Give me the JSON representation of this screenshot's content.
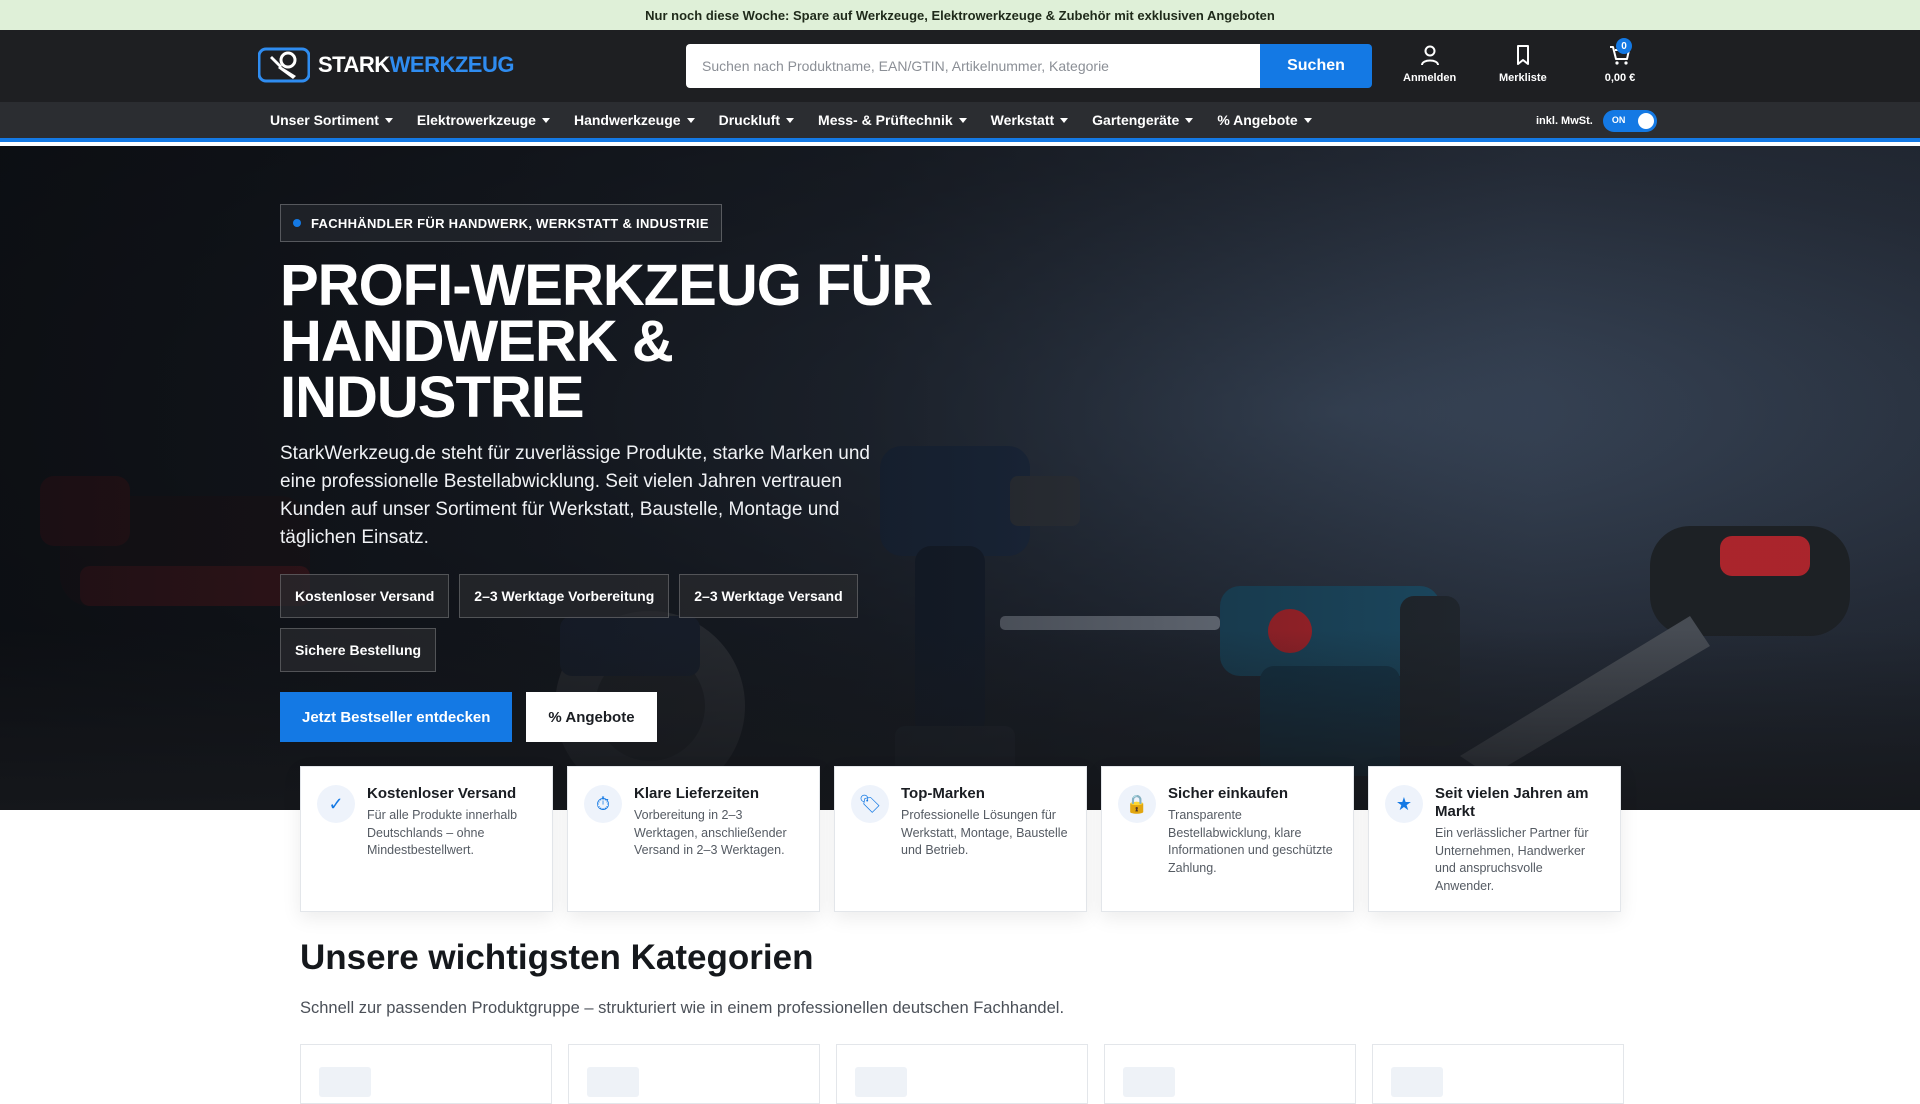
{
  "promo": {
    "text": "Nur noch diese Woche: Spare auf Werkzeuge, Elektrowerkzeuge & Zubehör mit exklusiven Angeboten"
  },
  "header": {
    "logo_part1": "STARK",
    "logo_part2": "WERKZEUG",
    "search_placeholder": "Suchen nach Produktname, EAN/GTIN, Artikelnummer, Kategorie",
    "search_button": "Suchen",
    "login_label": "Anmelden",
    "wishlist_label": "Merkliste",
    "cart_count": "0",
    "cart_total": "0,00 €"
  },
  "nav": {
    "items": [
      {
        "label": "Unser Sortiment"
      },
      {
        "label": "Elektrowerkzeuge"
      },
      {
        "label": "Handwerkzeuge"
      },
      {
        "label": "Druckluft"
      },
      {
        "label": "Mess- & Prüftechnik"
      },
      {
        "label": "Werkstatt"
      },
      {
        "label": "Gartengeräte"
      },
      {
        "label": "% Angebote"
      }
    ],
    "vat_label": "inkl. MwSt.",
    "vat_toggle": "ON"
  },
  "hero": {
    "eyebrow": "FACHHÄNDLER FÜR HANDWERK, WERKSTATT & INDUSTRIE",
    "title": "PROFI-WERKZEUG FÜR HANDWERK & INDUSTRIE",
    "text": "StarkWerkzeug.de steht für zuverlässige Produkte, starke Marken und eine professionelle Bestellabwicklung. Seit vielen Jahren vertrauen Kunden auf unser Sortiment für Werkstatt, Baustelle, Montage und täglichen Einsatz.",
    "chips": [
      {
        "label": "Kostenloser Versand"
      },
      {
        "label": "2–3 Werktage Vorbereitung"
      },
      {
        "label": "2–3 Werktage Versand"
      },
      {
        "label": "Sichere Bestellung"
      }
    ],
    "cta_primary": "Jetzt Bestseller entdecken",
    "cta_secondary": "% Angebote"
  },
  "features": [
    {
      "icon": "✓",
      "title": "Kostenloser Versand",
      "desc": "Für alle Produkte innerhalb Deutschlands – ohne Mindestbestellwert."
    },
    {
      "icon": "⏱",
      "title": "Klare Lieferzeiten",
      "desc": "Vorbereitung in 2–3 Werktagen, anschließender Versand in 2–3 Werktagen."
    },
    {
      "icon": "🏷",
      "title": "Top-Marken",
      "desc": "Professionelle Lösungen für Werkstatt, Montage, Baustelle und Betrieb."
    },
    {
      "icon": "🔒",
      "title": "Sicher einkaufen",
      "desc": "Transparente Bestellabwicklung, klare Informationen und geschützte Zahlung."
    },
    {
      "icon": "★",
      "title": "Seit vielen Jahren am Markt",
      "desc": "Ein verlässlicher Partner für Unternehmen, Handwerker und anspruchsvolle Anwender."
    }
  ],
  "categories": {
    "title": "Unsere wichtigsten Kategorien",
    "subtitle": "Schnell zur passenden Produktgruppe – strukturiert wie in einem professionellen deutschen Fachhandel."
  },
  "colors": {
    "accent": "#1479e4",
    "header_bg": "#1e1f22",
    "nav_bg": "#2b2d31",
    "promo_bg": "#dff0d8"
  }
}
